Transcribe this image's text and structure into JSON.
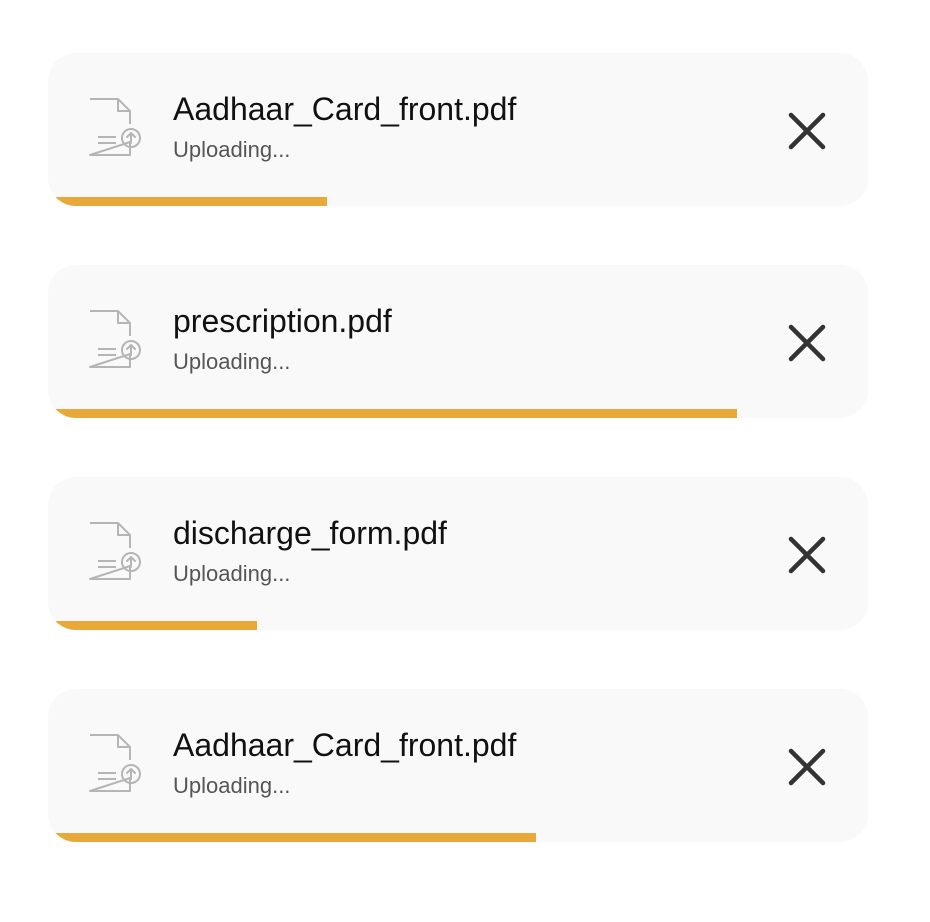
{
  "colors": {
    "card_background": "#f9f9f9",
    "progress": "#e8a93a",
    "title_text": "#111111",
    "status_text": "#555555",
    "icon_stroke": "#b5b5b5",
    "close_icon": "#333333"
  },
  "uploads": [
    {
      "file_name": "Aadhaar_Card_front.pdf",
      "status": "Uploading...",
      "progress": 0.34,
      "file_icon": "file-upload-icon",
      "close_icon": "close-icon"
    },
    {
      "file_name": "prescription.pdf",
      "status": "Uploading...",
      "progress": 0.84,
      "file_icon": "file-upload-icon",
      "close_icon": "close-icon"
    },
    {
      "file_name": "discharge_form.pdf",
      "status": "Uploading...",
      "progress": 0.255,
      "file_icon": "file-upload-icon",
      "close_icon": "close-icon"
    },
    {
      "file_name": "Aadhaar_Card_front.pdf",
      "status": "Uploading...",
      "progress": 0.595,
      "file_icon": "file-upload-icon",
      "close_icon": "close-icon"
    }
  ]
}
